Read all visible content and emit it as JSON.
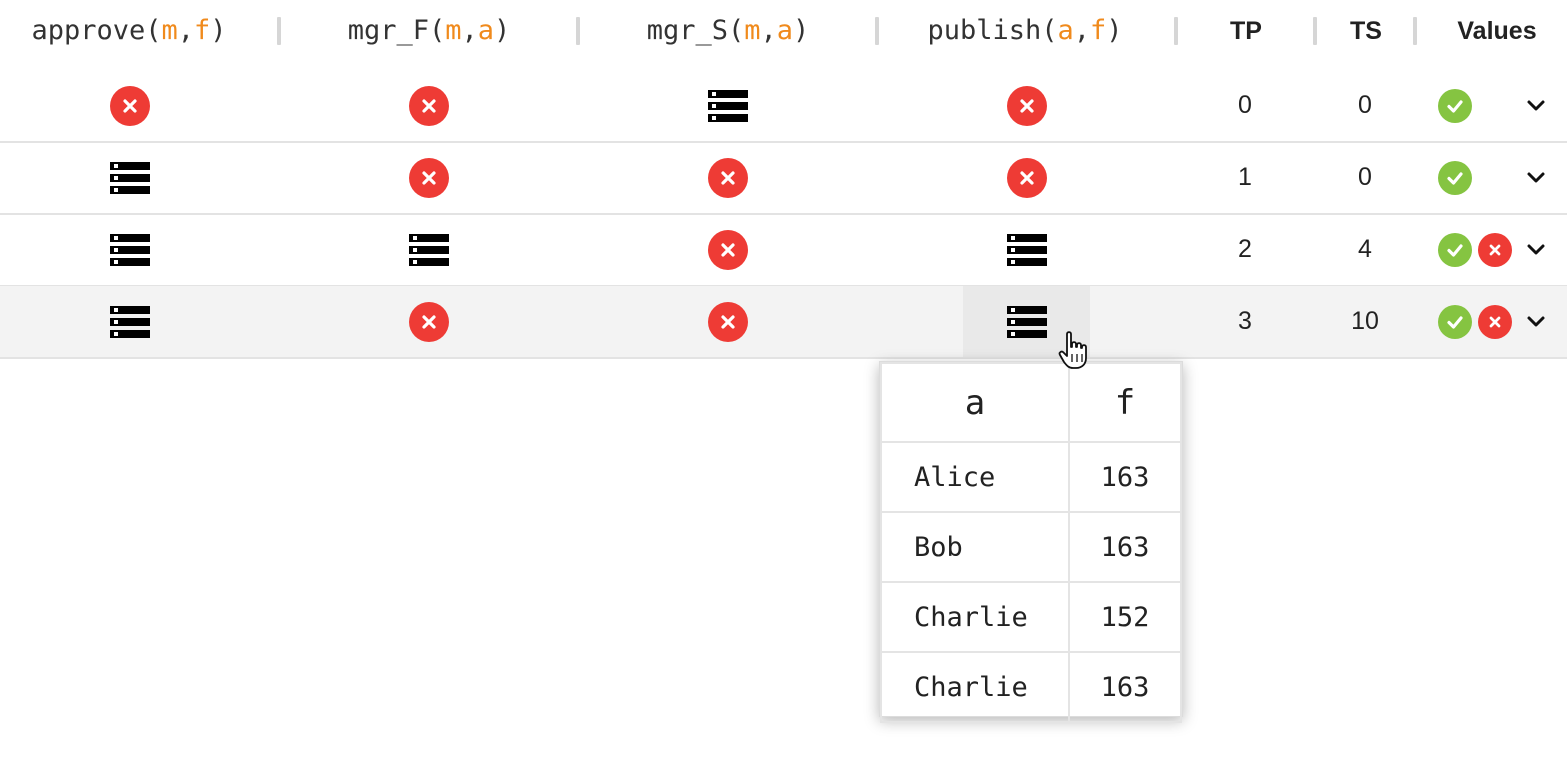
{
  "columns": [
    {
      "name": "approve",
      "args": [
        "m",
        "f"
      ]
    },
    {
      "name": "mgr_F",
      "args": [
        "m",
        "a"
      ]
    },
    {
      "name": "mgr_S",
      "args": [
        "m",
        "a"
      ]
    },
    {
      "name": "publish",
      "args": [
        "a",
        "f"
      ]
    }
  ],
  "headers": {
    "tp": "TP",
    "ts": "TS",
    "values": "Values"
  },
  "punct": {
    "open": "(",
    "comma": ", ",
    "close": ")"
  },
  "rows": [
    {
      "cells": [
        "x-icon",
        "x-icon",
        "table-icon",
        "x-icon"
      ],
      "tp": "0",
      "ts": "0",
      "values": [
        "check-icon"
      ]
    },
    {
      "cells": [
        "table-icon",
        "x-icon",
        "x-icon",
        "x-icon"
      ],
      "tp": "1",
      "ts": "0",
      "values": [
        "check-icon"
      ]
    },
    {
      "cells": [
        "table-icon",
        "table-icon",
        "x-icon",
        "table-icon"
      ],
      "tp": "2",
      "ts": "4",
      "values": [
        "check-icon",
        "x-icon"
      ]
    },
    {
      "cells": [
        "table-icon",
        "x-icon",
        "x-icon",
        "table-icon"
      ],
      "tp": "3",
      "ts": "10",
      "values": [
        "check-icon",
        "x-icon"
      ]
    }
  ],
  "popup": {
    "columns": [
      "a",
      "f"
    ],
    "rows": [
      [
        "Alice",
        "163"
      ],
      [
        "Bob",
        "163"
      ],
      [
        "Charlie",
        "152"
      ],
      [
        "Charlie",
        "163"
      ]
    ]
  },
  "colors": {
    "accent_arg": "#f08a1c",
    "error": "#ee3b35",
    "success": "#85c441"
  },
  "icons": {
    "expand": "chevron-down-icon",
    "cursor": "hand-pointer-icon"
  }
}
